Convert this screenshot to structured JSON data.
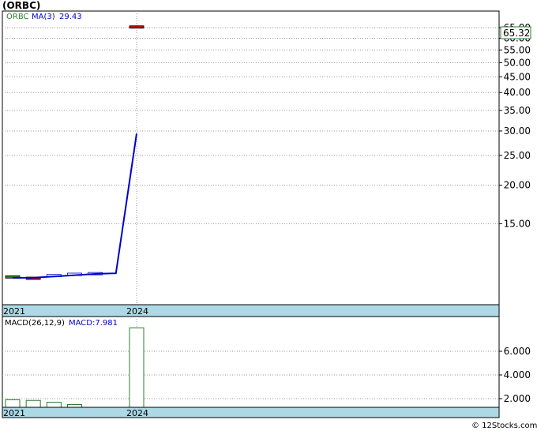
{
  "title": "(ORBC)",
  "credit": "© 12Stocks.com",
  "chart_data": [
    {
      "type": "line",
      "panel": "price",
      "legend": {
        "ticker": "ORBC",
        "ma_label": "MA(3)",
        "ma_value": "29.43"
      },
      "x_labels": [
        "2021",
        "2024"
      ],
      "y_ticks": [
        "15.00",
        "20.00",
        "25.00",
        "30.00",
        "35.00",
        "40.00",
        "45.00",
        "50.00",
        "55.00",
        "60.00",
        "65.00"
      ],
      "ylim": [
        10,
        66
      ],
      "y_scale": "log",
      "last_price_label": "65.32",
      "candles": [
        {
          "year": 2021.0,
          "open": 10.0,
          "close": 10.1,
          "color": "#2e7d32"
        },
        {
          "year": 2021.5,
          "open": 10.0,
          "close": 9.9,
          "color": "#cc0000"
        },
        {
          "year": 2022.0,
          "open": 10.1,
          "close": 10.2,
          "color": "#ffffff"
        },
        {
          "year": 2022.5,
          "open": 10.2,
          "close": 10.3,
          "color": "#ffffff"
        },
        {
          "year": 2023.0,
          "open": 10.3,
          "close": 10.35,
          "color": "#ffffff"
        },
        {
          "year": 2024.0,
          "open": 65.5,
          "close": 64.8,
          "color": "#cc0000"
        }
      ],
      "ma_series": {
        "name": "MA(3)",
        "color": "#0000cc",
        "points": [
          {
            "year": 2021.0,
            "value": 10.0
          },
          {
            "year": 2021.5,
            "value": 10.02
          },
          {
            "year": 2022.0,
            "value": 10.1
          },
          {
            "year": 2022.5,
            "value": 10.2
          },
          {
            "year": 2023.0,
            "value": 10.3
          },
          {
            "year": 2023.5,
            "value": 10.35
          },
          {
            "year": 2024.0,
            "value": 29.43
          }
        ]
      }
    },
    {
      "type": "bar",
      "panel": "macd",
      "legend": {
        "label": "MACD(26,12,9)",
        "macd_label": "MACD:7.981"
      },
      "x_labels": [
        "2021",
        "2024"
      ],
      "y_ticks": [
        "2.000",
        "4.000",
        "6.000"
      ],
      "ylim": [
        1,
        8
      ],
      "bars": [
        {
          "year": 2021.0,
          "value": 1.9
        },
        {
          "year": 2021.5,
          "value": 1.85
        },
        {
          "year": 2022.0,
          "value": 1.7
        },
        {
          "year": 2022.5,
          "value": 1.5
        },
        {
          "year": 2024.0,
          "value": 7.981
        }
      ]
    }
  ]
}
